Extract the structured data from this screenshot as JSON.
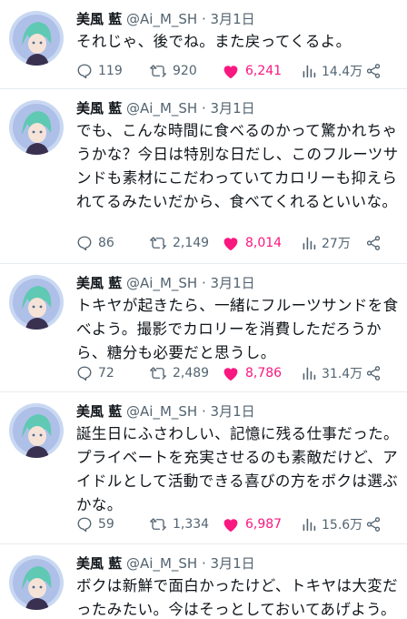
{
  "colors": {
    "like": "#f91880",
    "meta": "#536471",
    "text": "#0f1419",
    "divider": "#e6ecf0"
  },
  "icons": [
    "reply-icon",
    "retweet-icon",
    "heart-icon",
    "views-icon",
    "share-icon"
  ],
  "tweets": [
    {
      "name": "美風 藍",
      "handle": "@Ai_M_SH",
      "dot": "·",
      "date": "3月1日",
      "text": "それじゃ、後でね。また戻ってくるよ。",
      "replies": "119",
      "retweets": "920",
      "likes": "6,241",
      "views": "14.4万"
    },
    {
      "name": "美風 藍",
      "handle": "@Ai_M_SH",
      "dot": "·",
      "date": "3月1日",
      "text": "でも、こんな時間に食べるのかって驚かれちゃうかな？今日は特別な日だし、このフルーツサンドも素材にこだわっていてカロリーも抑えられてるみたいだから、食べてくれるといいな。",
      "replies": "86",
      "retweets": "2,149",
      "likes": "8,014",
      "views": "27万"
    },
    {
      "name": "美風 藍",
      "handle": "@Ai_M_SH",
      "dot": "·",
      "date": "3月1日",
      "text": "トキヤが起きたら、一緒にフルーツサンドを食べよう。撮影でカロリーを消費しただろうから、糖分も必要だと思うし。",
      "replies": "72",
      "retweets": "2,489",
      "likes": "8,786",
      "views": "31.4万"
    },
    {
      "name": "美風 藍",
      "handle": "@Ai_M_SH",
      "dot": "·",
      "date": "3月1日",
      "text": "誕生日にふさわしい、記憶に残る仕事だった。プライベートを充実させるのも素敵だけど、アイドルとして活動できる喜びの方をボクは選ぶかな。",
      "replies": "59",
      "retweets": "1,334",
      "likes": "6,987",
      "views": "15.6万"
    },
    {
      "name": "美風 藍",
      "handle": "@Ai_M_SH",
      "dot": "·",
      "date": "3月1日",
      "text": "ボクは新鮮で面白かったけど、トキヤは大変だったみたい。今はそっとしておいてあげよう。"
    }
  ]
}
